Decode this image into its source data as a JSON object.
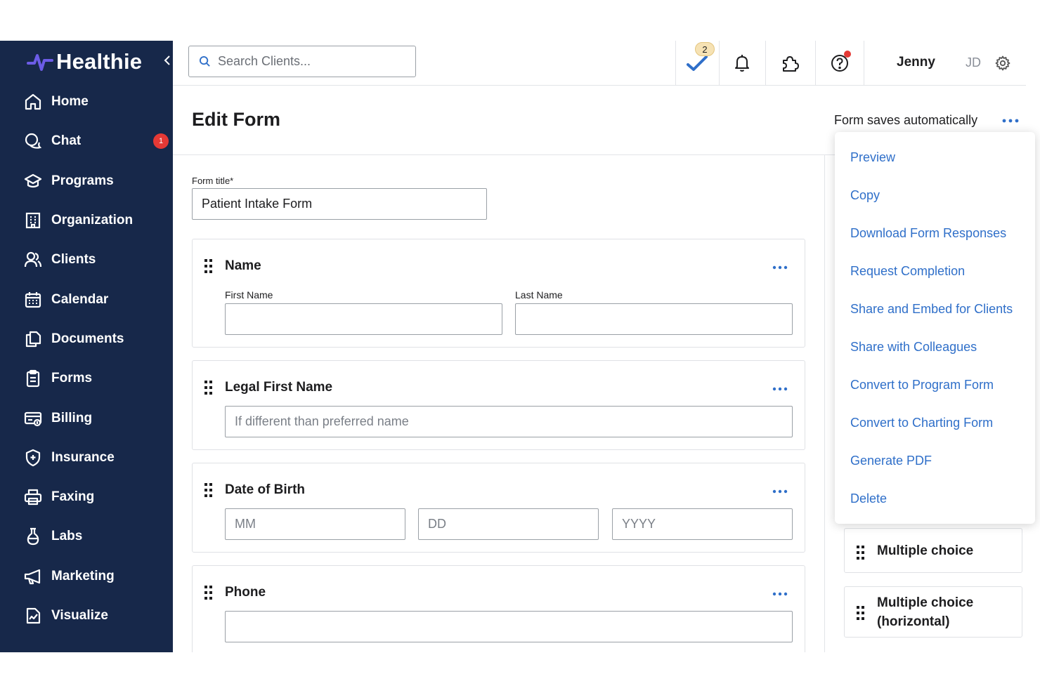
{
  "brand": {
    "name": "Healthie"
  },
  "sidebar": {
    "items": [
      {
        "label": "Home",
        "icon": "home-icon"
      },
      {
        "label": "Chat",
        "icon": "chat-icon",
        "badge": "1"
      },
      {
        "label": "Programs",
        "icon": "programs-icon"
      },
      {
        "label": "Organization",
        "icon": "organization-icon"
      },
      {
        "label": "Clients",
        "icon": "clients-icon"
      },
      {
        "label": "Calendar",
        "icon": "calendar-icon"
      },
      {
        "label": "Documents",
        "icon": "documents-icon"
      },
      {
        "label": "Forms",
        "icon": "forms-icon"
      },
      {
        "label": "Billing",
        "icon": "billing-icon"
      },
      {
        "label": "Insurance",
        "icon": "insurance-icon"
      },
      {
        "label": "Faxing",
        "icon": "faxing-icon"
      },
      {
        "label": "Labs",
        "icon": "labs-icon"
      },
      {
        "label": "Marketing",
        "icon": "marketing-icon"
      },
      {
        "label": "Visualize",
        "icon": "visualize-icon"
      }
    ]
  },
  "topbar": {
    "search_placeholder": "Search Clients...",
    "todo_count": "2",
    "user_name": "Jenny",
    "user_initials": "JD"
  },
  "page": {
    "title": "Edit Form",
    "autosave_text": "Form saves automatically"
  },
  "form": {
    "title_label": "Form title*",
    "title_value": "Patient Intake Form",
    "fields": {
      "name": {
        "title": "Name",
        "first_label": "First Name",
        "last_label": "Last Name"
      },
      "legal": {
        "title": "Legal First Name",
        "placeholder": "If different than preferred name"
      },
      "dob": {
        "title": "Date of Birth",
        "mm": "MM",
        "dd": "DD",
        "yyyy": "YYYY"
      },
      "phone": {
        "title": "Phone"
      }
    }
  },
  "side_fields": [
    {
      "label": "Multiple choice"
    },
    {
      "label_line1": "Multiple choice",
      "label_line2": "(horizontal)"
    }
  ],
  "menu": {
    "items": [
      "Preview",
      "Copy",
      "Download Form Responses",
      "Request Completion",
      "Share and Embed for Clients",
      "Share with Colleagues",
      "Convert to Program Form",
      "Convert to Charting Form",
      "Generate PDF",
      "Delete"
    ]
  },
  "colors": {
    "sidebar_bg": "#17284a",
    "accent_blue": "#2f6fc9",
    "badge_red": "#e53935",
    "logo_purple": "#6c5ce7"
  }
}
